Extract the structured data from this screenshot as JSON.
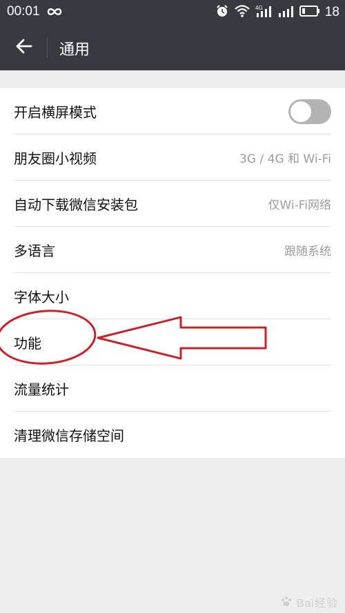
{
  "status_bar": {
    "time": "00:01",
    "battery_level": "18",
    "icons": [
      "infinity-icon",
      "alarm-icon",
      "wifi-icon",
      "signal-4g-icon",
      "signal-icon",
      "battery-icon"
    ]
  },
  "nav": {
    "title": "通用",
    "back_icon": "back-arrow-icon"
  },
  "settings": {
    "items": [
      {
        "label": "开启横屏模式",
        "value": "",
        "toggle_on": false
      },
      {
        "label": "朋友圈小视频",
        "value": "3G / 4G 和 Wi-Fi"
      },
      {
        "label": "自动下载微信安装包",
        "value": "仅Wi-Fi网络"
      },
      {
        "label": "多语言",
        "value": "跟随系统"
      },
      {
        "label": "字体大小",
        "value": ""
      },
      {
        "label": "功能",
        "value": ""
      },
      {
        "label": "流量统计",
        "value": ""
      },
      {
        "label": "清理微信存储空间",
        "value": ""
      }
    ]
  },
  "annotation": {
    "color": "#cc2029",
    "highlighted_item": "功能"
  },
  "watermark": {
    "text": "Bai经验"
  },
  "colors": {
    "header_bg": "#393a3f",
    "page_bg": "#eeeeef",
    "toggle_off": "#b3b3b3"
  }
}
